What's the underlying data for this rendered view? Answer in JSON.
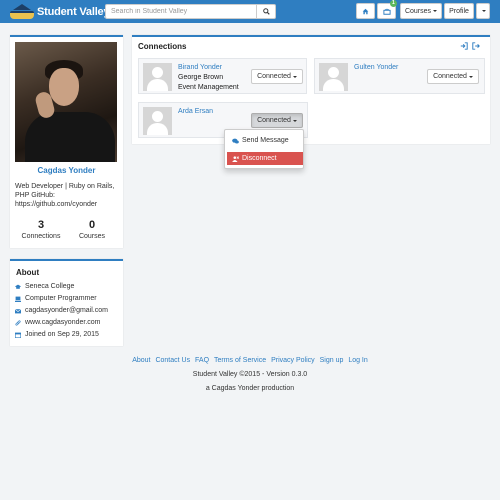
{
  "navbar": {
    "brand": "Student Valley",
    "search_placeholder": "Search in Student Valley",
    "notification_count": "1",
    "courses_label": "Courses",
    "profile_label": "Profile"
  },
  "profile": {
    "name": "Cagdas Yonder",
    "bio": "Web Developer | Ruby on Rails, PHP GitHub: https://github.com/cyonder",
    "stats": [
      {
        "value": "3",
        "label": "Connections"
      },
      {
        "value": "0",
        "label": "Courses"
      }
    ]
  },
  "about": {
    "title": "About",
    "items": [
      {
        "icon": "graduation-cap-icon",
        "text": "Seneca College"
      },
      {
        "icon": "laptop-icon",
        "text": "Computer Programmer"
      },
      {
        "icon": "envelope-icon",
        "text": "cagdasyonder@gmail.com"
      },
      {
        "icon": "link-icon",
        "text": "www.cagdasyonder.com"
      },
      {
        "icon": "calendar-icon",
        "text": "Joined on Sep 29, 2015"
      }
    ]
  },
  "connections": {
    "title": "Connections",
    "items": [
      {
        "name": "Birand Yonder",
        "line1": "George Brown",
        "line2": "Event Management",
        "status": "Connected"
      },
      {
        "name": "Gulten Yonder",
        "line1": "",
        "line2": "",
        "status": "Connected"
      },
      {
        "name": "Arda Ersan",
        "line1": "",
        "line2": "",
        "status": "Connected"
      }
    ],
    "dropdown": {
      "send_message": "Send Message",
      "disconnect": "Disconnect"
    }
  },
  "footer": {
    "links": [
      "About",
      "Contact Us",
      "FAQ",
      "Terms of Service",
      "Privacy Policy",
      "Sign up",
      "Log In"
    ],
    "copyright": "Student Valley ©2015 - Version 0.3.0",
    "credit": "a Cagdas Yonder production"
  },
  "colors": {
    "primary": "#2f7ec1",
    "danger": "#d9534f",
    "badge": "#5cb85c",
    "background": "#f2f4f6"
  }
}
